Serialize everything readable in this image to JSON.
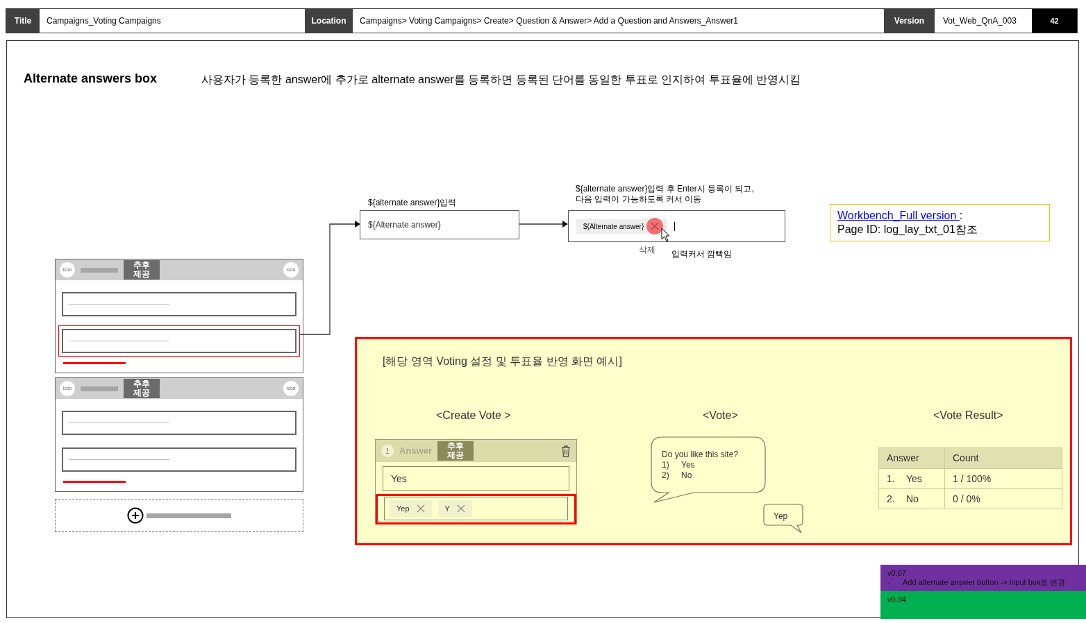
{
  "header": {
    "title_label": "Title",
    "title": "Campaigns_Voting Campaigns",
    "location_label": "Location",
    "location": "Campaigns> Voting Campaigns> Create> Question & Answer> Add a Question and Answers_Answer1",
    "version_label": "Version",
    "version": "Vot_Web_QnA_003",
    "page": "42"
  },
  "heading": "Alternate answers box",
  "description": "사용자가 등록한 answer에 추가로 alternate answer를 등록하면 등록된 단어를 동일한 투표로 인지하여 투표율에 반영시킴",
  "wireframe": {
    "cards": [
      {
        "icons": [
          "icon",
          "icon"
        ],
        "badge": "추후 제공",
        "fields": [
          {
            "highlighted": false
          },
          {
            "highlighted": true
          }
        ]
      },
      {
        "icons": [
          "icon",
          "icon"
        ],
        "badge": "추후 제공",
        "fields": [
          {
            "highlighted": false
          },
          {
            "highlighted": false
          }
        ]
      }
    ]
  },
  "flow": {
    "step1": {
      "caption": "${alternate answer}입력",
      "placeholder": "${Alternate answer}"
    },
    "step2": {
      "caption_lines": [
        "${alternate answer}입력 후 Enter시 등록이 되고,",
        "다음 입력이 가능하도록 커서 이동"
      ],
      "chip": "${Alternate answer}",
      "delete_label": "삭제",
      "cursor_note": "입력커서 깜빡임"
    }
  },
  "reference_note": {
    "link": "Workbench_Full version ",
    "suffix": ":",
    "page_id": "Page ID: log_lay_txt_01참조"
  },
  "example": {
    "title": "[해당 영역 Voting 설정 및 투표율 반영 화면 예시]",
    "create_vote": {
      "heading": "<Create Vote >",
      "index": "1",
      "label": "Answer",
      "badge": "추후 제공",
      "answer": "Yes",
      "alternates": [
        "Yep",
        "Y"
      ]
    },
    "vote": {
      "heading": "<Vote>",
      "question": "Do you like this site?",
      "options": [
        {
          "num": "1)",
          "text": "Yes"
        },
        {
          "num": "2)",
          "text": "No"
        }
      ],
      "reply": "Yep"
    },
    "result": {
      "heading": "<Vote Result>",
      "columns": [
        "Answer",
        "Count"
      ],
      "rows": [
        {
          "num": "1.",
          "answer": "Yes",
          "count": "1 / 100%"
        },
        {
          "num": "2.",
          "answer": "No",
          "count": "0 / 0%"
        }
      ]
    }
  },
  "version_notes": [
    {
      "version": "v0.07",
      "items": [
        {
          "bullet": "-",
          "text": "Add alternate answer button -> input box로 변경"
        }
      ],
      "color": "#7030a0"
    },
    {
      "version": "v0.04",
      "color": "#00b050"
    }
  ]
}
